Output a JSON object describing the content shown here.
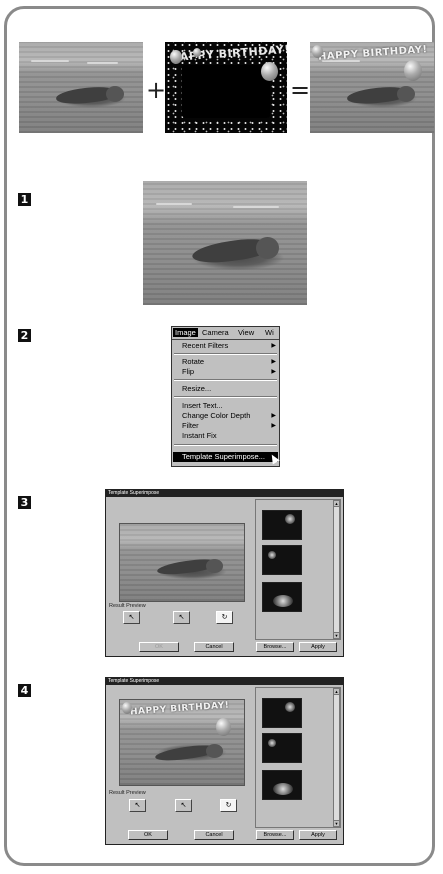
{
  "equation": {
    "plus": "+",
    "equals": "="
  },
  "template_text": "HAPPY BIRTHDAY!",
  "steps": [
    "1",
    "2",
    "3",
    "4"
  ],
  "menu": {
    "bar": [
      "Image",
      "Camera",
      "View",
      "Wi"
    ],
    "items": [
      {
        "label": "Recent Filters",
        "submenu": true
      },
      {
        "label": "Rotate",
        "submenu": true
      },
      {
        "label": "Flip",
        "submenu": true
      },
      {
        "label": "Resize...",
        "submenu": false
      },
      {
        "label": "Insert Text...",
        "submenu": false
      },
      {
        "label": "Change Color Depth",
        "submenu": true
      },
      {
        "label": "Filter",
        "submenu": true
      },
      {
        "label": "Instant Fix",
        "submenu": false
      },
      {
        "label": "Template Superimpose...",
        "submenu": false
      }
    ]
  },
  "dialog": {
    "title": "Template Superimpose",
    "result_preview": "Result Preview",
    "ok": "OK",
    "cancel": "Cancel",
    "browse": "Browse...",
    "apply": "Apply"
  },
  "colors": {
    "border": "#8a8a8a",
    "dialog_bg": "#c0c0c0",
    "step_badge": "#111111"
  }
}
